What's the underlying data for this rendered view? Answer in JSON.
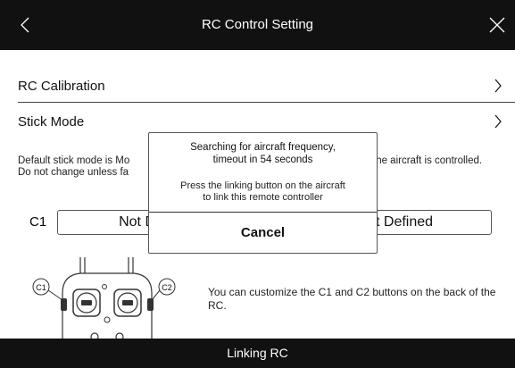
{
  "header": {
    "title": "RC Control Setting",
    "back_icon": "chevron-left-icon",
    "close_icon": "close-icon"
  },
  "rows": [
    {
      "label": "RC Calibration"
    },
    {
      "label": "Stick Mode"
    }
  ],
  "description": {
    "line1_left": "Default stick mode is Mo",
    "line1_right": "the aircraft is controlled.",
    "line2_left": "Do not change unless fa"
  },
  "custom_buttons": {
    "c1_label": "C1",
    "c1_value": "Not De",
    "c2_value": "t Defined",
    "c1_marker": "C1",
    "c2_marker": "C2",
    "note": "You can customize the C1 and C2 buttons on the back of the RC."
  },
  "dialog": {
    "message_line1": "Searching for aircraft frequency,",
    "message_line2": "timeout in 54 seconds",
    "hint_line1": "Press the linking button on the aircraft",
    "hint_line2": "to link this remote controller",
    "cancel_label": "Cancel"
  },
  "footer": {
    "label": "Linking RC"
  }
}
